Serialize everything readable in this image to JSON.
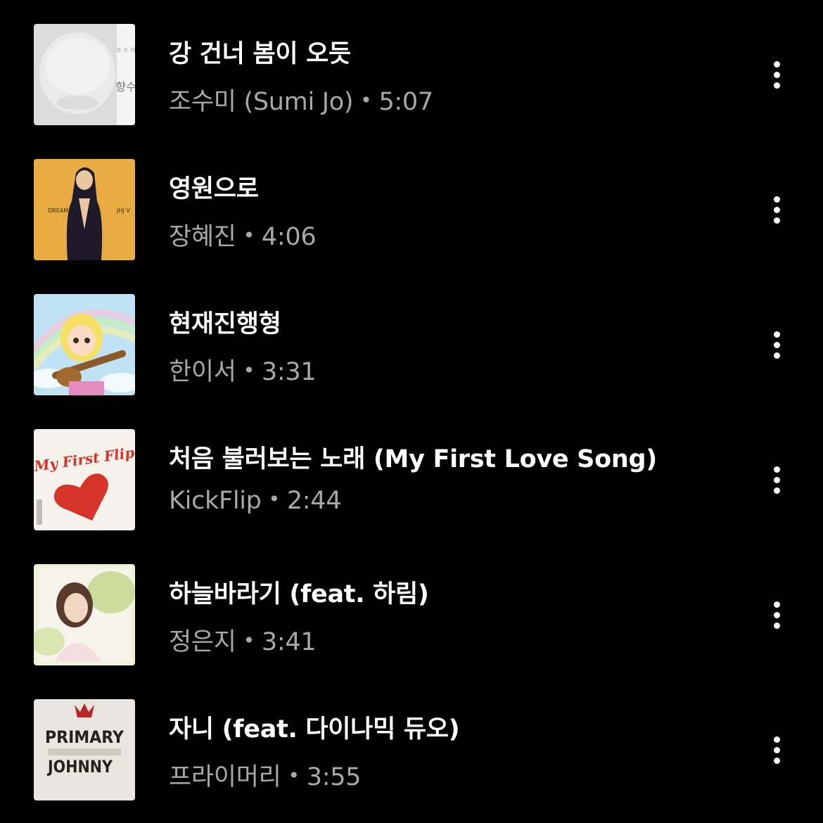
{
  "songs": [
    {
      "title": "강 건너 봄이 오듯",
      "artist": "조수미 (Sumi Jo)",
      "duration": "5:07",
      "art": "moon-jar-album-art"
    },
    {
      "title": "영원으로",
      "artist": "장혜진",
      "duration": "4:06",
      "art": "dream-album-art"
    },
    {
      "title": "현재진행형",
      "artist": "한이서",
      "duration": "3:31",
      "art": "cartoon-guitar-album-art"
    },
    {
      "title": "처음 불러보는 노래 (My First Love Song)",
      "artist": "KickFlip",
      "duration": "2:44",
      "art": "kickflip-album-art"
    },
    {
      "title": "하늘바라기 (feat. 하림)",
      "artist": "정은지",
      "duration": "3:41",
      "art": "portrait-album-art"
    },
    {
      "title": "자니 (feat. 다이나믹 듀오)",
      "artist": "프라이머리",
      "duration": "3:55",
      "art": "primary-johnny-album-art"
    }
  ],
  "separator": "•",
  "art_text": {
    "dream_left": "DREAM",
    "dream_right": "JHJ V",
    "primary_line1": "PRIMARY",
    "primary_line2": "JOHNNY",
    "kickflip_logo": "My First Flip"
  },
  "more_icon": "more-vertical-icon"
}
